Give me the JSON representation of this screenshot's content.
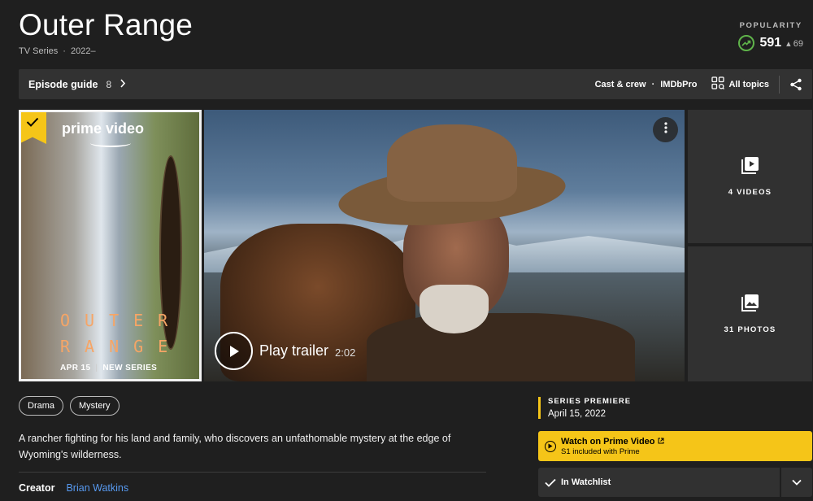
{
  "header": {
    "title": "Outer Range",
    "type": "TV Series",
    "years": "2022–"
  },
  "popularity": {
    "label": "POPULARITY",
    "value": "591",
    "delta": "69",
    "trend": "up",
    "trend_color": "#5fb34a"
  },
  "subnav": {
    "episode_guide_label": "Episode guide",
    "episode_count": "8",
    "cast_crew_label": "Cast & crew",
    "imdbpro_label": "IMDbPro",
    "all_topics_label": "All topics",
    "share_icon": "share-icon"
  },
  "poster": {
    "logo_text": "prime video",
    "title_line1": "OUTER",
    "title_line2": "RANGE",
    "date": "APR 15",
    "tag": "NEW SERIES",
    "in_watchlist": true
  },
  "trailer": {
    "play_label": "Play trailer",
    "duration": "2:02"
  },
  "media_tiles": {
    "videos_label": "4 VIDEOS",
    "photos_label": "31 PHOTOS"
  },
  "genres": [
    "Drama",
    "Mystery"
  ],
  "plot": "A rancher fighting for his land and family, who discovers an unfathomable mystery at the edge of Wyoming's wilderness.",
  "creator": {
    "label": "Creator",
    "name": "Brian Watkins"
  },
  "premiere": {
    "label": "SERIES PREMIERE",
    "date": "April 15, 2022"
  },
  "watch": {
    "title": "Watch on Prime Video",
    "subtitle": "S1 included with Prime"
  },
  "watchlist": {
    "label": "In Watchlist"
  },
  "colors": {
    "accent": "#f5c518",
    "link": "#5799ef",
    "background": "#1f1f1f"
  }
}
